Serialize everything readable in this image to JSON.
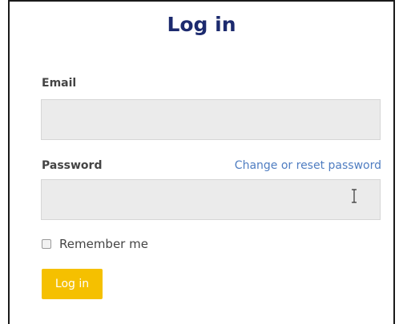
{
  "form": {
    "title": "Log in",
    "email": {
      "label": "Email",
      "value": "",
      "placeholder": ""
    },
    "password": {
      "label": "Password",
      "value": "",
      "placeholder": "",
      "reset_link": "Change or reset password"
    },
    "remember": {
      "label": "Remember me",
      "checked": false
    },
    "submit_label": "Log in"
  },
  "colors": {
    "title": "#1c2a6e",
    "link": "#4f7dc1",
    "button": "#f5c000",
    "field_background": "#ebebeb",
    "frame_border": "#1a1a1a"
  },
  "icons": {
    "cursor": "text-cursor-icon"
  }
}
